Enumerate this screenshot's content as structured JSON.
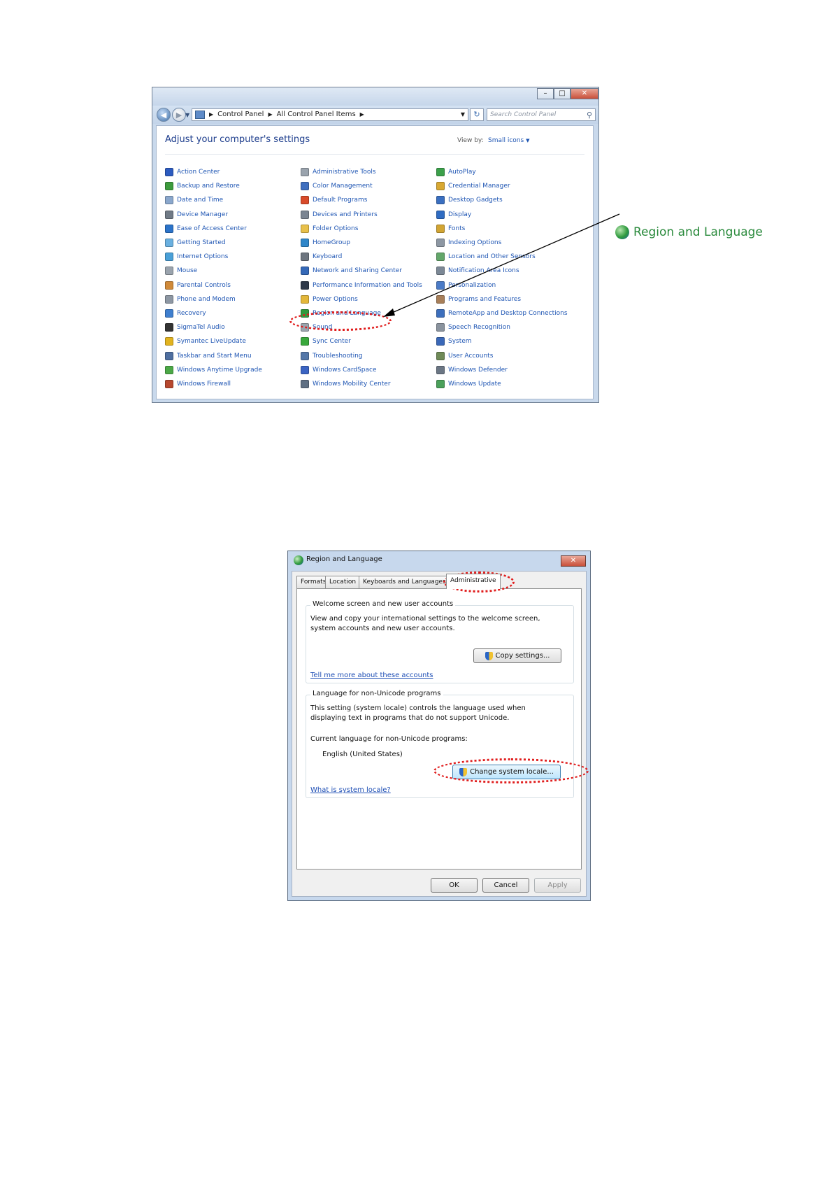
{
  "control_panel": {
    "address": {
      "crumbs": [
        "Control Panel",
        "All Control Panel Items"
      ],
      "search_placeholder": "Search Control Panel"
    },
    "heading": "Adjust your computer's settings",
    "view_by_label": "View by:",
    "view_by_value": "Small icons",
    "columns": [
      [
        {
          "label": "Action Center",
          "color": "#2c5bc0"
        },
        {
          "label": "Backup and Restore",
          "color": "#3d9b3d"
        },
        {
          "label": "Date and Time",
          "color": "#8aa7cc"
        },
        {
          "label": "Device Manager",
          "color": "#707a86"
        },
        {
          "label": "Ease of Access Center",
          "color": "#2b73c9"
        },
        {
          "label": "Getting Started",
          "color": "#6ab0e0"
        },
        {
          "label": "Internet Options",
          "color": "#4aa0d8"
        },
        {
          "label": "Mouse",
          "color": "#9aa3ad"
        },
        {
          "label": "Parental Controls",
          "color": "#d08a3a"
        },
        {
          "label": "Phone and Modem",
          "color": "#8d97a3"
        },
        {
          "label": "Recovery",
          "color": "#3f7fcf"
        },
        {
          "label": "SigmaTel Audio",
          "color": "#333333"
        },
        {
          "label": "Symantec LiveUpdate",
          "color": "#e2b31f"
        },
        {
          "label": "Taskbar and Start Menu",
          "color": "#4f6fa0"
        },
        {
          "label": "Windows Anytime Upgrade",
          "color": "#4ba846"
        },
        {
          "label": "Windows Firewall",
          "color": "#b7482f"
        }
      ],
      [
        {
          "label": "Administrative Tools",
          "color": "#9aa3ad"
        },
        {
          "label": "Color Management",
          "color": "#3f6fbf"
        },
        {
          "label": "Default Programs",
          "color": "#d94b2a"
        },
        {
          "label": "Devices and Printers",
          "color": "#7b8592"
        },
        {
          "label": "Folder Options",
          "color": "#e8c04a"
        },
        {
          "label": "HomeGroup",
          "color": "#2f86c9"
        },
        {
          "label": "Keyboard",
          "color": "#6d757f"
        },
        {
          "label": "Network and Sharing Center",
          "color": "#3569b8"
        },
        {
          "label": "Performance Information and Tools",
          "color": "#2f3a4a"
        },
        {
          "label": "Power Options",
          "color": "#e3b73a"
        },
        {
          "label": "Region and Language",
          "color": "#2f9a3d"
        },
        {
          "label": "Sound",
          "color": "#9aa3ad"
        },
        {
          "label": "Sync Center",
          "color": "#39a83c"
        },
        {
          "label": "Troubleshooting",
          "color": "#5477a8"
        },
        {
          "label": "Windows CardSpace",
          "color": "#3b64c3"
        },
        {
          "label": "Windows Mobility Center",
          "color": "#5f6f83"
        }
      ],
      [
        {
          "label": "AutoPlay",
          "color": "#3ba04a"
        },
        {
          "label": "Credential Manager",
          "color": "#d8a832"
        },
        {
          "label": "Desktop Gadgets",
          "color": "#3a6fc0"
        },
        {
          "label": "Display",
          "color": "#2f6cc3"
        },
        {
          "label": "Fonts",
          "color": "#d2a533"
        },
        {
          "label": "Indexing Options",
          "color": "#8d97a3"
        },
        {
          "label": "Location and Other Sensors",
          "color": "#63a76a"
        },
        {
          "label": "Notification Area Icons",
          "color": "#7c8896"
        },
        {
          "label": "Personalization",
          "color": "#4b7bc7"
        },
        {
          "label": "Programs and Features",
          "color": "#a87f59"
        },
        {
          "label": "RemoteApp and Desktop Connections",
          "color": "#3d6fbd"
        },
        {
          "label": "Speech Recognition",
          "color": "#8a939e"
        },
        {
          "label": "System",
          "color": "#3a68b8"
        },
        {
          "label": "User Accounts",
          "color": "#6f8a57"
        },
        {
          "label": "Windows Defender",
          "color": "#6b7684"
        },
        {
          "label": "Windows Update",
          "color": "#4aa05a"
        }
      ]
    ]
  },
  "callout": {
    "label": "Region and Language"
  },
  "dialog": {
    "title": "Region and Language",
    "tabs": [
      "Formats",
      "Location",
      "Keyboards and Languages",
      "Administrative"
    ],
    "welcome_group": {
      "title": "Welcome screen and new user accounts",
      "description": "View and copy your international settings to the welcome screen, system accounts and new user accounts.",
      "copy_button": "Copy settings...",
      "link": "Tell me more about these accounts"
    },
    "unicode_group": {
      "title": "Language for non-Unicode programs",
      "description": "This setting (system locale) controls the language used when displaying text in programs that do not support Unicode.",
      "current_label": "Current language for non-Unicode programs:",
      "current_value": "English (United States)",
      "change_button": "Change system locale...",
      "link": "What is system locale?"
    },
    "buttons": {
      "ok": "OK",
      "cancel": "Cancel",
      "apply": "Apply"
    }
  },
  "colors": {
    "highlight": "#e01d1d",
    "link": "#1e55b3",
    "callout_text": "#2a8a3c"
  }
}
